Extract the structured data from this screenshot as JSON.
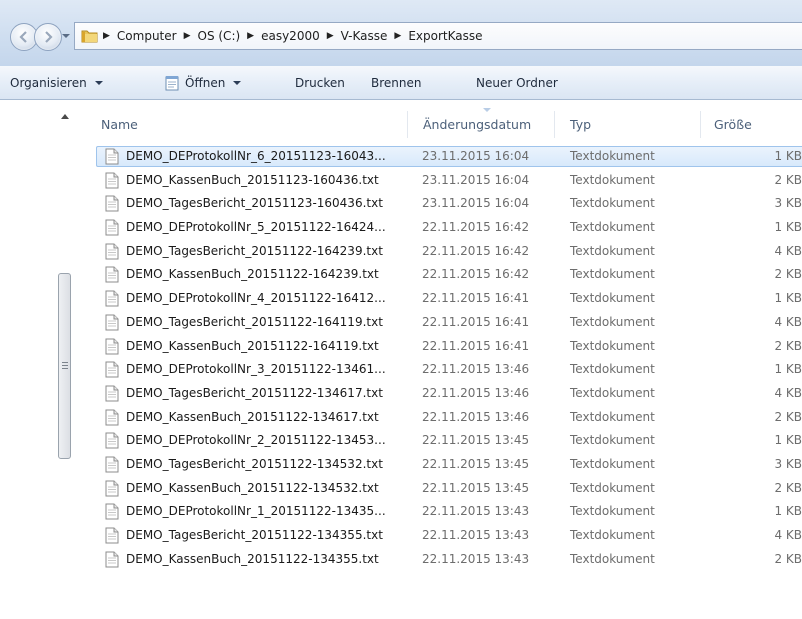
{
  "breadcrumb": [
    "Computer",
    "OS (C:)",
    "easy2000",
    "V-Kasse",
    "ExportKasse"
  ],
  "toolbar": {
    "organize": "Organisieren",
    "open": "Öffnen",
    "print": "Drucken",
    "burn": "Brennen",
    "new_folder": "Neuer Ordner"
  },
  "columns": {
    "name": "Name",
    "date": "Änderungsdatum",
    "type": "Typ",
    "size": "Größe"
  },
  "selected_index": 0,
  "files": [
    {
      "name": "DEMO_DEProtokollNr_6_20151123-16043...",
      "date": "23.11.2015 16:04",
      "type": "Textdokument",
      "size": "1 KB"
    },
    {
      "name": "DEMO_KassenBuch_20151123-160436.txt",
      "date": "23.11.2015 16:04",
      "type": "Textdokument",
      "size": "2 KB"
    },
    {
      "name": "DEMO_TagesBericht_20151123-160436.txt",
      "date": "23.11.2015 16:04",
      "type": "Textdokument",
      "size": "3 KB"
    },
    {
      "name": "DEMO_DEProtokollNr_5_20151122-16424...",
      "date": "22.11.2015 16:42",
      "type": "Textdokument",
      "size": "1 KB"
    },
    {
      "name": "DEMO_TagesBericht_20151122-164239.txt",
      "date": "22.11.2015 16:42",
      "type": "Textdokument",
      "size": "4 KB"
    },
    {
      "name": "DEMO_KassenBuch_20151122-164239.txt",
      "date": "22.11.2015 16:42",
      "type": "Textdokument",
      "size": "2 KB"
    },
    {
      "name": "DEMO_DEProtokollNr_4_20151122-16412...",
      "date": "22.11.2015 16:41",
      "type": "Textdokument",
      "size": "1 KB"
    },
    {
      "name": "DEMO_TagesBericht_20151122-164119.txt",
      "date": "22.11.2015 16:41",
      "type": "Textdokument",
      "size": "4 KB"
    },
    {
      "name": "DEMO_KassenBuch_20151122-164119.txt",
      "date": "22.11.2015 16:41",
      "type": "Textdokument",
      "size": "2 KB"
    },
    {
      "name": "DEMO_DEProtokollNr_3_20151122-13461...",
      "date": "22.11.2015 13:46",
      "type": "Textdokument",
      "size": "1 KB"
    },
    {
      "name": "DEMO_TagesBericht_20151122-134617.txt",
      "date": "22.11.2015 13:46",
      "type": "Textdokument",
      "size": "4 KB"
    },
    {
      "name": "DEMO_KassenBuch_20151122-134617.txt",
      "date": "22.11.2015 13:46",
      "type": "Textdokument",
      "size": "2 KB"
    },
    {
      "name": "DEMO_DEProtokollNr_2_20151122-13453...",
      "date": "22.11.2015 13:45",
      "type": "Textdokument",
      "size": "1 KB"
    },
    {
      "name": "DEMO_TagesBericht_20151122-134532.txt",
      "date": "22.11.2015 13:45",
      "type": "Textdokument",
      "size": "3 KB"
    },
    {
      "name": "DEMO_KassenBuch_20151122-134532.txt",
      "date": "22.11.2015 13:45",
      "type": "Textdokument",
      "size": "2 KB"
    },
    {
      "name": "DEMO_DEProtokollNr_1_20151122-13435...",
      "date": "22.11.2015 13:43",
      "type": "Textdokument",
      "size": "1 KB"
    },
    {
      "name": "DEMO_TagesBericht_20151122-134355.txt",
      "date": "22.11.2015 13:43",
      "type": "Textdokument",
      "size": "4 KB"
    },
    {
      "name": "DEMO_KassenBuch_20151122-134355.txt",
      "date": "22.11.2015 13:43",
      "type": "Textdokument",
      "size": "2 KB"
    }
  ],
  "icons": {
    "back": "back-arrow-icon",
    "forward": "forward-arrow-icon",
    "folder": "folder-icon",
    "open": "notepad-icon",
    "file": "text-file-icon"
  }
}
